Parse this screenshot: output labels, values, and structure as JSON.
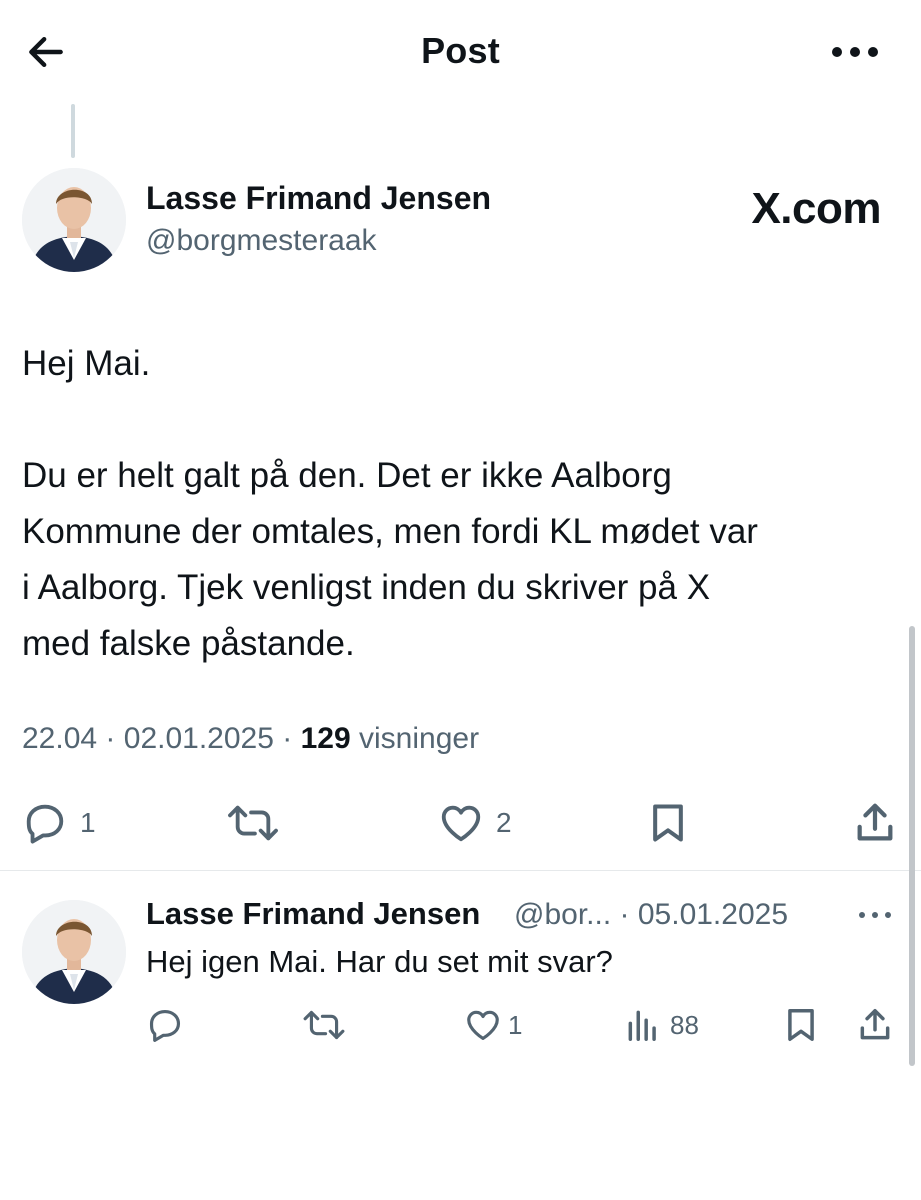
{
  "header": {
    "title": "Post",
    "back_icon": "arrow-left-icon",
    "more_icon": "more-horizontal-icon"
  },
  "post": {
    "author_name": "Lasse Frimand Jensen",
    "author_handle": "@borgmesteraak",
    "watermark": "X.com",
    "greeting": "Hej Mai.",
    "body_lines": [
      "Du er helt galt på den. Det er ikke Aalborg",
      "Kommune der omtales, men fordi KL mødet var",
      "i Aalborg. Tjek venligst inden du skriver på X",
      "med falske påstande."
    ],
    "time": "22.04",
    "date": "02.01.2025",
    "views_count": "129",
    "views_label": "visninger",
    "separator": "·",
    "actions": {
      "reply_count": "1",
      "like_count": "2"
    }
  },
  "reply": {
    "author_name": "Lasse Frimand Jensen",
    "handle_truncated": "@bor...",
    "separator": "·",
    "date": "05.01.2025",
    "text": "Hej igen Mai. Har du set mit svar?",
    "actions": {
      "like_count": "1",
      "views_count": "88"
    }
  },
  "colors": {
    "text": "#0f1419",
    "secondary": "#536471",
    "divider": "#e6e9eb"
  }
}
